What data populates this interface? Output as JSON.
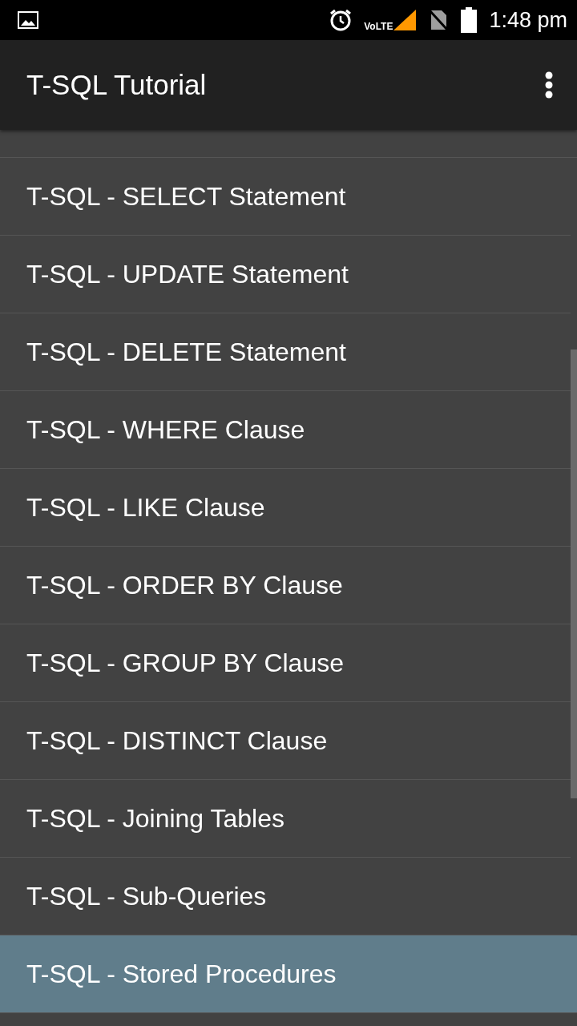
{
  "status_bar": {
    "network": "VoLTE",
    "time": "1:48 pm"
  },
  "app_bar": {
    "title": "T-SQL Tutorial"
  },
  "items": [
    {
      "label": "T-SQL - SELECT Statement",
      "selected": false
    },
    {
      "label": "T-SQL - UPDATE Statement",
      "selected": false
    },
    {
      "label": "T-SQL - DELETE Statement",
      "selected": false
    },
    {
      "label": "T-SQL - WHERE Clause",
      "selected": false
    },
    {
      "label": "T-SQL - LIKE Clause",
      "selected": false
    },
    {
      "label": "T-SQL - ORDER BY Clause",
      "selected": false
    },
    {
      "label": "T-SQL - GROUP BY Clause",
      "selected": false
    },
    {
      "label": "T-SQL - DISTINCT Clause",
      "selected": false
    },
    {
      "label": "T-SQL - Joining Tables",
      "selected": false
    },
    {
      "label": "T-SQL - Sub-Queries",
      "selected": false
    },
    {
      "label": "T-SQL - Stored Procedures",
      "selected": true
    }
  ]
}
